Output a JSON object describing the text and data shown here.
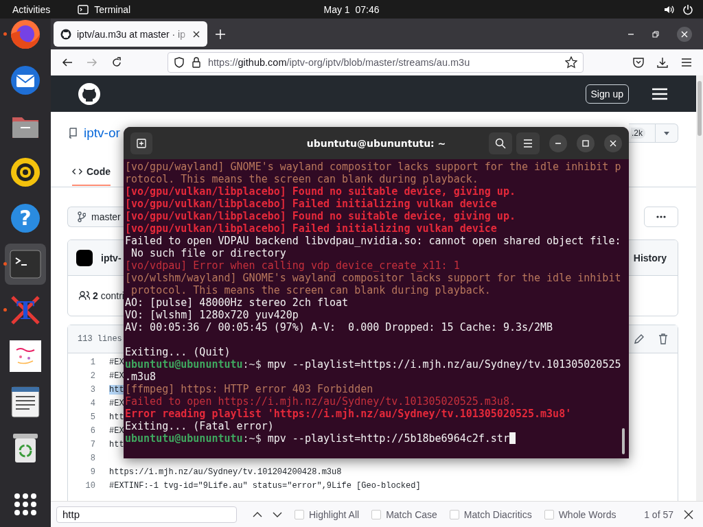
{
  "top_bar": {
    "activities": "Activities",
    "app": "Terminal",
    "clock": "May 1  07:46"
  },
  "dock": [
    {
      "kind": "browser",
      "running": true,
      "active": false
    },
    {
      "kind": "mail",
      "running": false,
      "active": false
    },
    {
      "kind": "folder",
      "running": false,
      "active": false
    },
    {
      "kind": "speaker",
      "running": false,
      "active": false
    },
    {
      "kind": "help",
      "glyph": "?",
      "running": false,
      "active": false
    },
    {
      "kind": "terminal",
      "running": true,
      "active": true
    },
    {
      "kind": "letter",
      "glyph": "T",
      "running": true,
      "active": false
    },
    {
      "kind": "image",
      "running": false,
      "active": false
    },
    {
      "kind": "document",
      "running": false,
      "active": false
    },
    {
      "kind": "trash",
      "running": false,
      "active": false
    },
    {
      "kind": "grid",
      "running": false,
      "active": false
    }
  ],
  "browser": {
    "tab": {
      "title": "iptv/au.m3u at master · ip",
      "selected": true
    },
    "forward_disabled": true,
    "url": {
      "scheme": "https://",
      "domain": "github.com",
      "path": "/iptv-org/iptv/blob/master/streams/au.m3u"
    }
  },
  "github": {
    "sign_up": "Sign up",
    "repo_owner": "iptv-or",
    "star_count": ".2k",
    "code_tab": {
      "label": "Code",
      "selected": true
    },
    "branch": "master",
    "commit_author": "iptv-",
    "history": "History",
    "contributors": "**2** contri",
    "file_info": "113 lines",
    "code_lines": [
      {
        "number": "1",
        "text": "#EX",
        "match": false
      },
      {
        "number": "2",
        "text": "#EX",
        "match": false
      },
      {
        "number": "3",
        "text": "htt",
        "match": true
      },
      {
        "number": "4",
        "text": "#EX",
        "match": false
      },
      {
        "number": "5",
        "text": "htt",
        "match": false
      },
      {
        "number": "6",
        "text": "#EX",
        "match": false
      },
      {
        "number": "7",
        "text": "htt",
        "match": false
      },
      {
        "number": "8"
      },
      {
        "number": "9",
        "text": "https://i.mjh.nz/au/Sydney/tv.101204200428.m3u8",
        "match": false
      },
      {
        "number": "10",
        "text": "#EXTINF:-1 tvg-id=\"9Life.au\" status=\"error\",9Life [Geo-blocked]",
        "match": false
      }
    ]
  },
  "find_bar": {
    "query": "http",
    "options": [
      {
        "label": "Highlight All",
        "checked": false
      },
      {
        "label": "Match Case",
        "checked": false
      },
      {
        "label": "Match Diacritics",
        "checked": false
      },
      {
        "label": "Whole Words",
        "checked": false
      }
    ],
    "result": "1 of 57"
  },
  "terminal": {
    "title": "ubuntutu@ubununtutu: ~",
    "lines": [
      {
        "kind": "warn",
        "text": "[vo/gpu/wayland] GNOME's wayland compositor lacks support for the idle inhibit p"
      },
      {
        "kind": "warn",
        "text": "rotocol. This means the screen can blank during playback."
      },
      {
        "kind": "error",
        "text": "[vo/gpu/vulkan/libplacebo] Found no suitable device, giving up."
      },
      {
        "kind": "error",
        "text": "[vo/gpu/vulkan/libplacebo] Failed initializing vulkan device"
      },
      {
        "kind": "error",
        "text": "[vo/gpu/vulkan/libplacebo] Found no suitable device, giving up."
      },
      {
        "kind": "error",
        "text": "[vo/gpu/vulkan/libplacebo] Failed initializing vulkan device"
      },
      {
        "kind": "normal",
        "text": "Failed to open VDPAU backend libvdpau_nvidia.so: cannot open shared object file:"
      },
      {
        "kind": "normal",
        "text": " No such file or directory"
      },
      {
        "kind": "fail",
        "text": "[vo/vdpau] Error when calling vdp_device_create_x11: 1"
      },
      {
        "kind": "warn",
        "text": "[vo/wlshm/wayland] GNOME's wayland compositor lacks support for the idle inhibit"
      },
      {
        "kind": "warn",
        "text": " protocol. This means the screen can blank during playback."
      },
      {
        "kind": "normal",
        "text": "AO: [pulse] 48000Hz stereo 2ch float"
      },
      {
        "kind": "normal",
        "text": "VO: [wlshm] 1280x720 yuv420p"
      },
      {
        "kind": "normal",
        "text": "AV: 00:05:36 / 00:05:45 (97%) A-V:  0.000 Dropped: 15 Cache: 9.3s/2MB"
      },
      {
        "kind": "blank"
      },
      {
        "kind": "normal",
        "text": "Exiting... (Quit)"
      },
      {
        "kind": "prompt",
        "user": "ubuntutu@ubununtutu",
        "path": ":~$",
        "text": " mpv --playlist=https://i.mjh.nz/au/Sydney/tv.101305020525",
        "cursor": false
      },
      {
        "kind": "normal",
        "text": ".m3u8"
      },
      {
        "kind": "warn",
        "text": "[ffmpeg] https: HTTP error 403 Forbidden"
      },
      {
        "kind": "fail",
        "text": "Failed to open https://i.mjh.nz/au/Sydney/tv.101305020525.m3u8."
      },
      {
        "kind": "error",
        "text": "Error reading playlist 'https://i.mjh.nz/au/Sydney/tv.101305020525.m3u8'"
      },
      {
        "kind": "normal",
        "text": "Exiting... (Fatal error)"
      },
      {
        "kind": "prompt",
        "user": "ubuntutu@ubununtutu",
        "path": ":~$",
        "text": " mpv --playlist=http://5b18be6964c2f.str",
        "cursor": true
      }
    ]
  }
}
